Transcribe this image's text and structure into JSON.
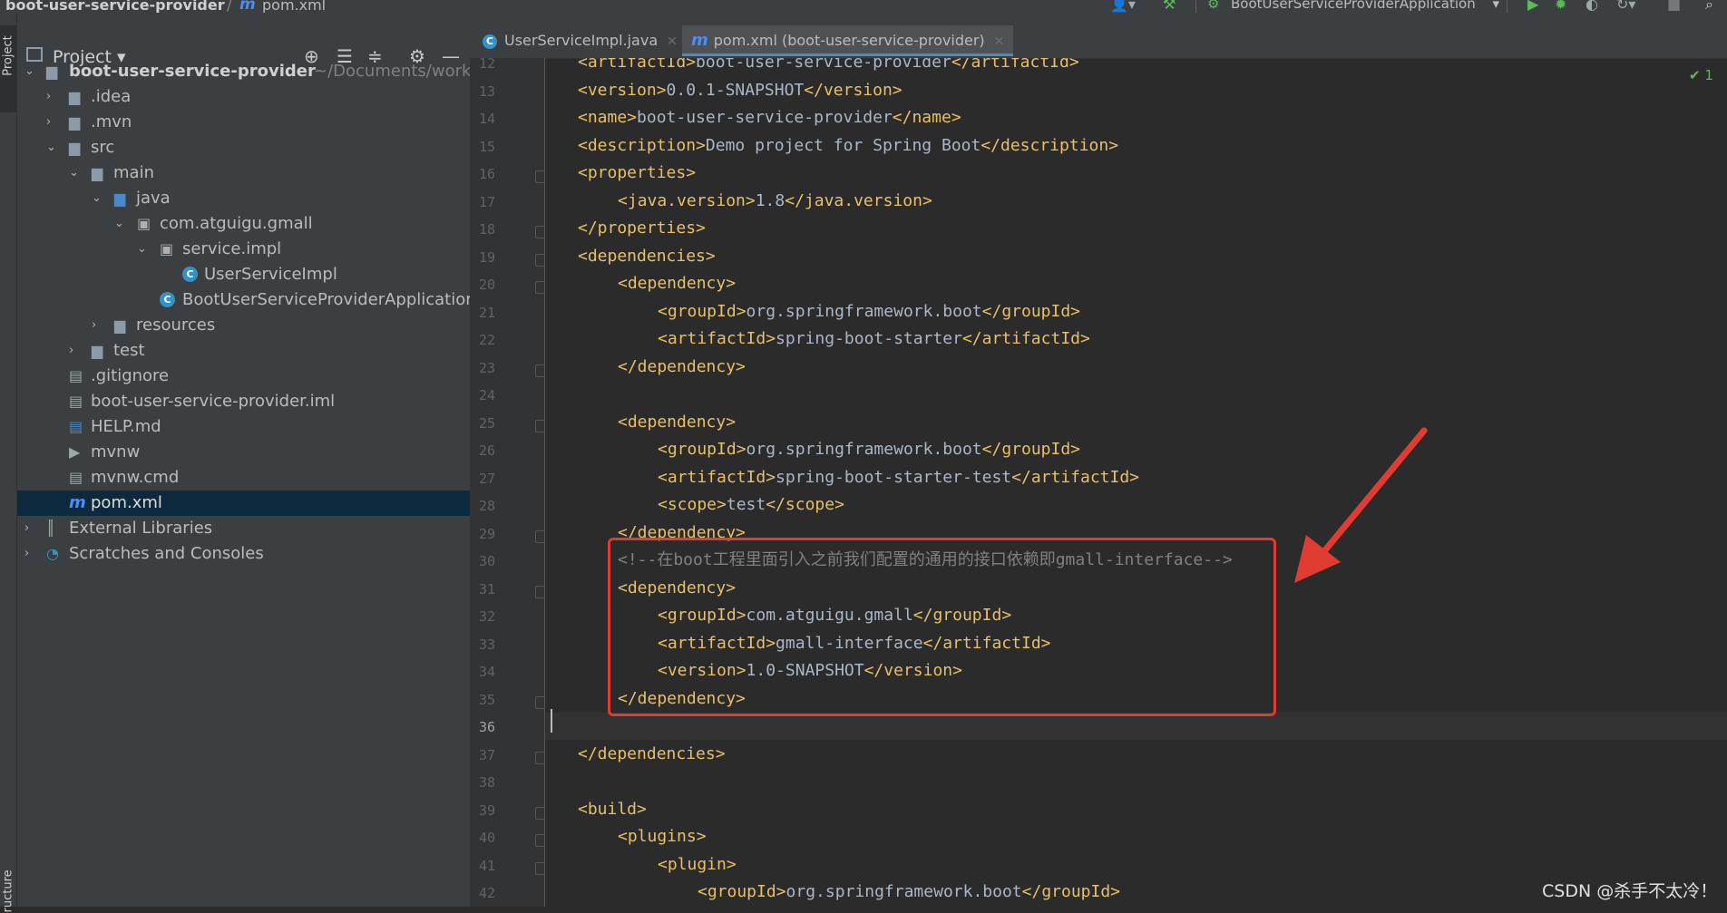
{
  "navbar": {
    "project_name": "boot-user-service-provider",
    "separator": "/",
    "file_name": "pom.xml",
    "run_config": "BootUserServiceProviderApplication"
  },
  "left_stripe": {
    "project_tab": "Project",
    "structure_tab": "ructure"
  },
  "project_panel": {
    "title": "Project",
    "tree": [
      {
        "label": "boot-user-service-provider",
        "hint": "~/Documents/worke",
        "expanded": true,
        "bold": true
      },
      {
        "label": ".idea",
        "expanded": false
      },
      {
        "label": ".mvn",
        "expanded": false
      },
      {
        "label": "src",
        "expanded": true
      },
      {
        "label": "main",
        "expanded": true
      },
      {
        "label": "java",
        "expanded": true
      },
      {
        "label": "com.atguigu.gmall",
        "expanded": true
      },
      {
        "label": "service.impl",
        "expanded": true
      },
      {
        "label": "UserServiceImpl"
      },
      {
        "label": "BootUserServiceProviderApplicatior"
      },
      {
        "label": "resources",
        "expanded": false
      },
      {
        "label": "test",
        "expanded": false
      },
      {
        "label": ".gitignore"
      },
      {
        "label": "boot-user-service-provider.iml"
      },
      {
        "label": "HELP.md"
      },
      {
        "label": "mvnw"
      },
      {
        "label": "mvnw.cmd"
      },
      {
        "label": "pom.xml",
        "selected": true
      },
      {
        "label": "External Libraries",
        "expanded": false
      },
      {
        "label": "Scratches and Consoles",
        "expanded": false
      }
    ]
  },
  "editor": {
    "tabs": [
      {
        "label": "UserServiceImpl.java",
        "active": false
      },
      {
        "label": "pom.xml (boot-user-service-provider)",
        "active": true
      }
    ],
    "inspection_count": "1",
    "lines": [
      {
        "n": "12",
        "text": "<artifactId>boot-user-service-provider</artifactId>"
      },
      {
        "n": "13",
        "text": "<version>0.0.1-SNAPSHOT</version>"
      },
      {
        "n": "14",
        "text": "<name>boot-user-service-provider</name>"
      },
      {
        "n": "15",
        "text": "<description>Demo project for Spring Boot</description>"
      },
      {
        "n": "16",
        "text": "<properties>"
      },
      {
        "n": "17",
        "text": "<java.version>1.8</java.version>"
      },
      {
        "n": "18",
        "text": "</properties>"
      },
      {
        "n": "19",
        "text": "<dependencies>"
      },
      {
        "n": "20",
        "text": "<dependency>"
      },
      {
        "n": "21",
        "text": "<groupId>org.springframework.boot</groupId>"
      },
      {
        "n": "22",
        "text": "<artifactId>spring-boot-starter</artifactId>"
      },
      {
        "n": "23",
        "text": "</dependency>"
      },
      {
        "n": "24",
        "text": ""
      },
      {
        "n": "25",
        "text": "<dependency>"
      },
      {
        "n": "26",
        "text": "<groupId>org.springframework.boot</groupId>"
      },
      {
        "n": "27",
        "text": "<artifactId>spring-boot-starter-test</artifactId>"
      },
      {
        "n": "28",
        "text": "<scope>test</scope>"
      },
      {
        "n": "29",
        "text": "</dependency>"
      },
      {
        "n": "30",
        "text": "<!--在boot工程里面引入之前我们配置的通用的接口依赖即gmall-interface-->"
      },
      {
        "n": "31",
        "text": "<dependency>"
      },
      {
        "n": "32",
        "text": "<groupId>com.atguigu.gmall</groupId>"
      },
      {
        "n": "33",
        "text": "<artifactId>gmall-interface</artifactId>"
      },
      {
        "n": "34",
        "text": "<version>1.0-SNAPSHOT</version>"
      },
      {
        "n": "35",
        "text": "</dependency>"
      },
      {
        "n": "36",
        "text": ""
      },
      {
        "n": "37",
        "text": "</dependencies>"
      },
      {
        "n": "38",
        "text": ""
      },
      {
        "n": "39",
        "text": "<build>"
      },
      {
        "n": "40",
        "text": "<plugins>"
      },
      {
        "n": "41",
        "text": "<plugin>"
      },
      {
        "n": "42",
        "text": "<groupId>org.springframework.boot</groupId>"
      }
    ]
  },
  "watermark": "CSDN @杀手不太冷！",
  "colors": {
    "tag": "#e8bf6a",
    "text": "#a9b7c6",
    "comment": "#808080",
    "annotation": "#e03c31",
    "selection": "#0d293e",
    "accent": "#4a88c7"
  }
}
